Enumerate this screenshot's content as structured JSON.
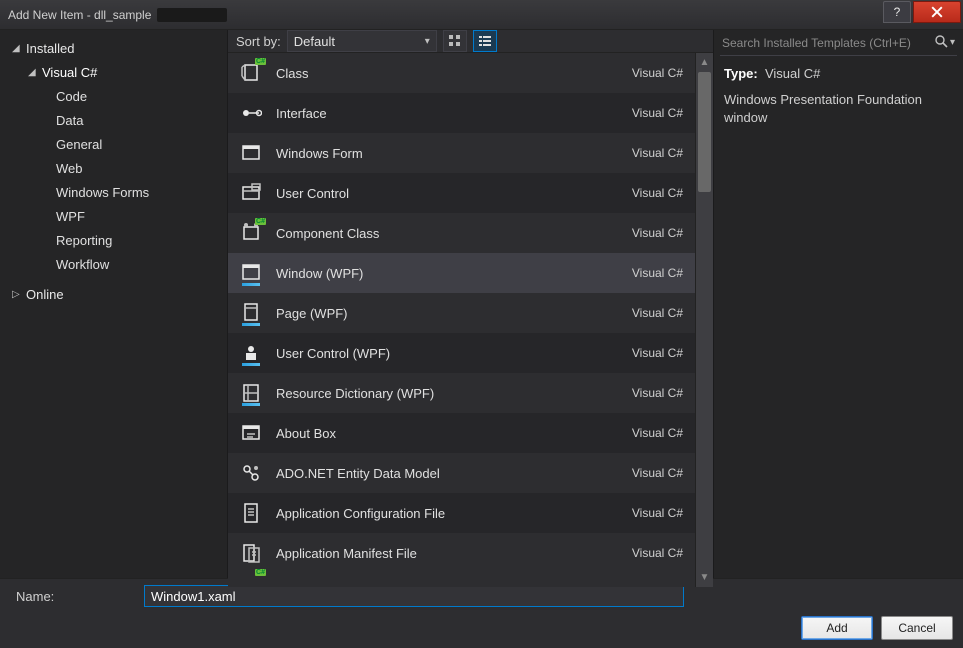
{
  "window": {
    "title": "Add New Item - dll_sample"
  },
  "nav": {
    "installed": "Installed",
    "visual_csharp": "Visual C#",
    "leaves": [
      "Code",
      "Data",
      "General",
      "Web",
      "Windows Forms",
      "WPF",
      "Reporting",
      "Workflow"
    ],
    "online": "Online"
  },
  "sortbar": {
    "label": "Sort by:",
    "value": "Default"
  },
  "templates": [
    {
      "name": "Class",
      "lang": "Visual C#",
      "icon": "class"
    },
    {
      "name": "Interface",
      "lang": "Visual C#",
      "icon": "interface"
    },
    {
      "name": "Windows Form",
      "lang": "Visual C#",
      "icon": "form"
    },
    {
      "name": "User Control",
      "lang": "Visual C#",
      "icon": "usercontrol"
    },
    {
      "name": "Component Class",
      "lang": "Visual C#",
      "icon": "component"
    },
    {
      "name": "Window (WPF)",
      "lang": "Visual C#",
      "icon": "window-wpf",
      "selected": true
    },
    {
      "name": "Page (WPF)",
      "lang": "Visual C#",
      "icon": "page-wpf"
    },
    {
      "name": "User Control (WPF)",
      "lang": "Visual C#",
      "icon": "usercontrol-wpf"
    },
    {
      "name": "Resource Dictionary (WPF)",
      "lang": "Visual C#",
      "icon": "resdict-wpf"
    },
    {
      "name": "About Box",
      "lang": "Visual C#",
      "icon": "aboutbox"
    },
    {
      "name": "ADO.NET Entity Data Model",
      "lang": "Visual C#",
      "icon": "ado-edm"
    },
    {
      "name": "Application Configuration File",
      "lang": "Visual C#",
      "icon": "appconfig"
    },
    {
      "name": "Application Manifest File",
      "lang": "Visual C#",
      "icon": "manifest"
    }
  ],
  "info": {
    "search_placeholder": "Search Installed Templates (Ctrl+E)",
    "type_label": "Type:",
    "type_value": "Visual C#",
    "description": "Windows Presentation Foundation window"
  },
  "name_field": {
    "label": "Name:",
    "value": "Window1.xaml"
  },
  "buttons": {
    "add": "Add",
    "cancel": "Cancel"
  }
}
